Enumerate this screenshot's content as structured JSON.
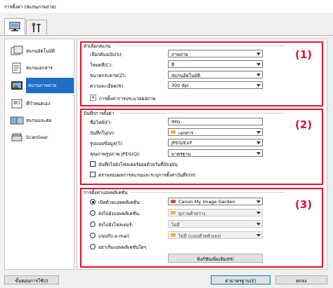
{
  "window": {
    "title": "การตั้งค่า (สแกนภาพถ่าย)"
  },
  "tabs": [
    {
      "icon": "scan-from-computer-icon",
      "active": true
    },
    {
      "icon": "general-settings-icon",
      "active": false
    }
  ],
  "sidebar": {
    "items": [
      {
        "label": "สแกนอัตโนมัติ",
        "icon": "auto-scan-icon",
        "selected": false
      },
      {
        "label": "สแกนเอกสาร",
        "icon": "document-scan-icon",
        "selected": false
      },
      {
        "label": "สแกนภาพถ่าย",
        "icon": "photo-scan-icon",
        "selected": true
      },
      {
        "label": "ที่กำหนดเอง",
        "icon": "custom-scan-icon",
        "selected": false
      },
      {
        "label": "สแกนและต่อ",
        "icon": "stitch-scan-icon",
        "selected": false
      },
      {
        "label": "ScanGear",
        "icon": "scangear-icon",
        "selected": false
      }
    ]
  },
  "annotations": {
    "n1": "(1)",
    "n2": "(2)",
    "n3": "(3)"
  },
  "scan_options": {
    "title": "ตัวเลือกสแกน",
    "rows": [
      {
        "label": "เลือกต้นฉบับ(S):",
        "value": "ภาพถ่าย"
      },
      {
        "label": "โหมดสี(C):",
        "value": "สี"
      },
      {
        "label": "ขนาดกระดาษ(Z):",
        "value": "สแกนอัตโนมัติ"
      },
      {
        "label": "ความละเอียด(R):",
        "value": "300 dpi"
      }
    ],
    "image_processing_label": "การตั้งค่าการประมวลผลภาพ"
  },
  "save_settings": {
    "title": "บันทึกการตั้งค่า",
    "file_name_label": "ชื่อไฟล์(F):",
    "file_name_value": "IMG",
    "save_in_label": "บันทึกใน(V):",
    "save_in_value": "เอกสาร",
    "data_format_label": "รูปแบบข้อมูล(T):",
    "data_format_value": "JPEG/Exif",
    "jpeg_quality_label": "คุณภาพรูปภาพ JPEG(Q):",
    "jpeg_quality_value": "มาตรฐาน",
    "subfolder_label": "บันทึกไปยังโฟลเดอร์ย่อยด้วยวันที่ปัจจุบัน",
    "check_results_label": "ตรวจสอบผลการสแกนและระบุการตั้งค่าบันทึก(H)"
  },
  "app_settings": {
    "title": "การตั้งค่าแอพพลิเคชั่น",
    "options": [
      {
        "label": "เปิดด้วยแอพพลิเคชั่น:",
        "value": "Canon My Image Garden",
        "selected": true
      },
      {
        "label": "ส่งไปยังแอพพลิเคชั่น:",
        "value": "ดูภาพด้วยว่าง",
        "selected": false
      },
      {
        "label": "ส่งไปยังโฟลเดอร์:",
        "value": "ไม่มี",
        "selected": false
      },
      {
        "label": "แนบกับ e-mail:",
        "value": "ไม่มี (แนบด้วยตัวเอง)",
        "selected": false
      },
      {
        "label": "อย่าเริ่มแอพพลิเคชั่นใดๆ",
        "value": "",
        "selected": false
      }
    ],
    "more_functions_label": "ฟังก์ชันเพิ่มเติม(M)"
  },
  "footer": {
    "instructions_label": "ขั้นตอนการใช้(I)",
    "defaults_label": "ค่ามาตรฐาน(E)",
    "ok_label": "ตกลง"
  },
  "colors": {
    "accent": "#1e6fc6",
    "annotation": "#e8112d"
  }
}
